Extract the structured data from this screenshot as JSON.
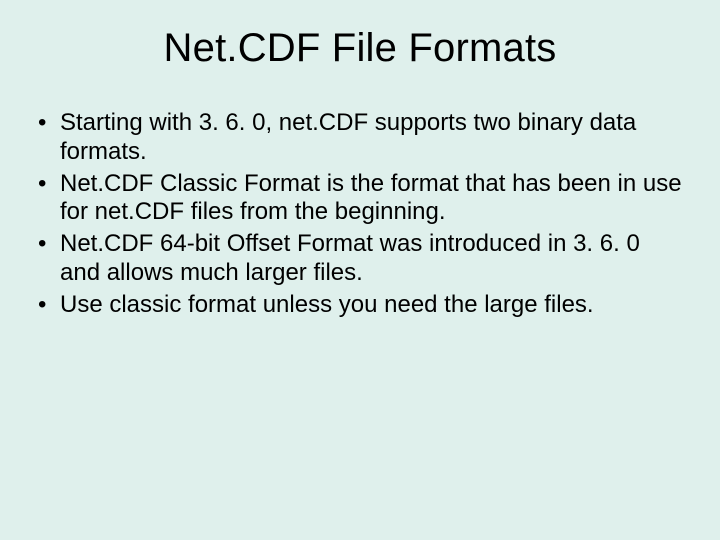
{
  "slide": {
    "title": "Net.CDF File Formats",
    "bullets": [
      "Starting with 3. 6. 0, net.CDF supports two binary data formats.",
      "Net.CDF Classic Format is the format that has been in use for net.CDF files from the beginning.",
      "Net.CDF 64-bit Offset Format was introduced in 3. 6. 0 and allows much larger files.",
      "Use classic format unless you need the large files."
    ]
  }
}
